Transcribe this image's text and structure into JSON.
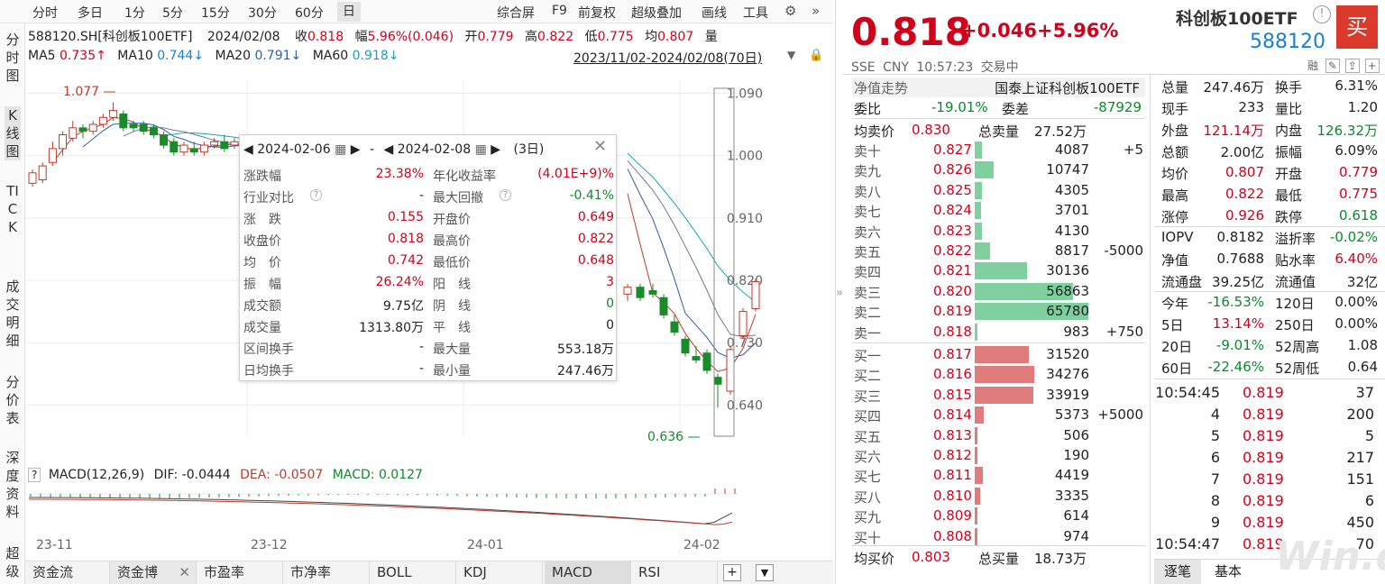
{
  "toolbar": {
    "periods": [
      "分时",
      "多日",
      "1分",
      "5分",
      "15分",
      "30分",
      "60分",
      "日"
    ],
    "active_period": "日",
    "right_items": [
      "综合屏",
      "F9",
      "前复权",
      "超级叠加",
      "画线",
      "工具"
    ]
  },
  "left_tabs": [
    "分时图",
    "K线图",
    "TICK",
    "成交明细",
    "分价表",
    "深度资料",
    "超级"
  ],
  "quote_line": {
    "code_name": "588120.SH[科创板100ETF]",
    "date": "2024/02/08",
    "close_label": "收",
    "close": "0.818",
    "range_label": "幅",
    "range": "5.96%(0.046)",
    "open_label": "开",
    "open": "0.779",
    "high_label": "高",
    "high": "0.822",
    "low_label": "低",
    "low": "0.775",
    "avg_label": "均",
    "avg": "0.807",
    "vol_label": "量"
  },
  "ma_line": {
    "ma5_label": "MA5",
    "ma5": "0.735↑",
    "ma10_label": "MA10",
    "ma10": "0.744↓",
    "ma20_label": "MA20",
    "ma20": "0.791↓",
    "ma60_label": "MA60",
    "ma60": "0.918↓",
    "date_range": "2023/11/02-2024/02/08(70日)"
  },
  "chart_data": {
    "type": "candlestick",
    "y_ticks": [
      "1.090",
      "1.000",
      "0.910",
      "0.820",
      "0.730",
      "0.640"
    ],
    "ylim": [
      0.595,
      1.11
    ],
    "x_labels": [
      "23-11",
      "23-12",
      "24-01",
      "24-02"
    ],
    "annotations": [
      {
        "text": "1.077"
      },
      {
        "text": "0.636"
      }
    ],
    "candles": [
      {
        "o": 0.96,
        "c": 0.975,
        "h": 0.98,
        "l": 0.955
      },
      {
        "o": 0.965,
        "c": 0.985,
        "h": 0.99,
        "l": 0.96
      },
      {
        "o": 0.99,
        "c": 1.01,
        "h": 1.02,
        "l": 0.985
      },
      {
        "o": 1.01,
        "c": 1.03,
        "h": 1.035,
        "l": 1.0
      },
      {
        "o": 1.025,
        "c": 1.04,
        "h": 1.05,
        "l": 1.02
      },
      {
        "o": 1.04,
        "c": 1.035,
        "h": 1.045,
        "l": 1.025
      },
      {
        "o": 1.035,
        "c": 1.045,
        "h": 1.05,
        "l": 1.03
      },
      {
        "o": 1.045,
        "c": 1.055,
        "h": 1.06,
        "l": 1.04
      },
      {
        "o": 1.055,
        "c": 1.065,
        "h": 1.077,
        "l": 1.05
      },
      {
        "o": 1.06,
        "c": 1.04,
        "h": 1.065,
        "l": 1.035
      },
      {
        "o": 1.045,
        "c": 1.04,
        "h": 1.05,
        "l": 1.035
      },
      {
        "o": 1.045,
        "c": 1.035,
        "h": 1.05,
        "l": 1.03
      },
      {
        "o": 1.04,
        "c": 1.03,
        "h": 1.045,
        "l": 1.025
      },
      {
        "o": 1.03,
        "c": 1.015,
        "h": 1.035,
        "l": 1.01
      },
      {
        "o": 1.02,
        "c": 1.005,
        "h": 1.025,
        "l": 1.0
      },
      {
        "o": 1.005,
        "c": 1.015,
        "h": 1.02,
        "l": 1.0
      },
      {
        "o": 1.01,
        "c": 1.005,
        "h": 1.02,
        "l": 1.0
      },
      {
        "o": 1.005,
        "c": 1.015,
        "h": 1.02,
        "l": 1.0
      },
      {
        "o": 1.015,
        "c": 1.02,
        "h": 1.025,
        "l": 1.01
      },
      {
        "o": 1.02,
        "c": 1.01,
        "h": 1.03,
        "l": 1.005
      },
      {
        "o": 1.015,
        "c": 1.02,
        "h": 1.025,
        "l": 1.01
      },
      {
        "o": 1.02,
        "c": 1.015,
        "h": 1.025,
        "l": 1.01
      },
      {
        "o": 1.02,
        "c": 1.01,
        "h": 1.025,
        "l": 1.005
      },
      {
        "o": 0.8,
        "c": 0.81,
        "h": 0.815,
        "l": 0.79
      },
      {
        "o": 0.81,
        "c": 0.795,
        "h": 0.815,
        "l": 0.79
      },
      {
        "o": 0.805,
        "c": 0.8,
        "h": 0.815,
        "l": 0.795
      },
      {
        "o": 0.795,
        "c": 0.77,
        "h": 0.8,
        "l": 0.765
      },
      {
        "o": 0.76,
        "c": 0.745,
        "h": 0.77,
        "l": 0.74
      },
      {
        "o": 0.735,
        "c": 0.715,
        "h": 0.74,
        "l": 0.71
      },
      {
        "o": 0.71,
        "c": 0.705,
        "h": 0.725,
        "l": 0.7
      },
      {
        "o": 0.715,
        "c": 0.69,
        "h": 0.72,
        "l": 0.685
      },
      {
        "o": 0.68,
        "c": 0.67,
        "h": 0.685,
        "l": 0.636
      },
      {
        "o": 0.66,
        "c": 0.72,
        "h": 0.725,
        "l": 0.655
      },
      {
        "o": 0.74,
        "c": 0.775,
        "h": 0.78,
        "l": 0.735
      },
      {
        "o": 0.779,
        "c": 0.818,
        "h": 0.822,
        "l": 0.775
      }
    ],
    "ma_series": [
      {
        "name": "MA5",
        "color": "#c0392b"
      },
      {
        "name": "MA10",
        "color": "#2d5fa5"
      },
      {
        "name": "MA20",
        "color": "#6b7b90"
      },
      {
        "name": "MA60",
        "color": "#1aa3b8"
      }
    ]
  },
  "popup": {
    "date_from": "2024-02-06",
    "date_to": "2024-02-08",
    "days": "(3日)",
    "rows": [
      {
        "l1": "涨跌幅",
        "v1": "23.38%",
        "l2": "年化收益率",
        "v2": "(4.01E+9)%",
        "c1": "red",
        "c2": "red"
      },
      {
        "l1": "行业对比",
        "v1": "-",
        "l2": "最大回撤",
        "v2": "-0.41%",
        "c1": "",
        "c2": "green"
      },
      {
        "l1": "涨　跌",
        "v1": "0.155",
        "l2": "开盘价",
        "v2": "0.649",
        "c1": "red",
        "c2": "red"
      },
      {
        "l1": "收盘价",
        "v1": "0.818",
        "l2": "最高价",
        "v2": "0.822",
        "c1": "red",
        "c2": "red"
      },
      {
        "l1": "均　价",
        "v1": "0.742",
        "l2": "最低价",
        "v2": "0.648",
        "c1": "red",
        "c2": "red"
      },
      {
        "l1": "振　幅",
        "v1": "26.24%",
        "l2": "阳　线",
        "v2": "3",
        "c1": "red",
        "c2": "red"
      },
      {
        "l1": "成交额",
        "v1": "9.75亿",
        "l2": "阴　线",
        "v2": "0",
        "c1": "",
        "c2": "green"
      },
      {
        "l1": "成交量",
        "v1": "1313.80万",
        "l2": "平　线",
        "v2": "0",
        "c1": "",
        "c2": ""
      },
      {
        "l1": "区间换手",
        "v1": "-",
        "l2": "最大量",
        "v2": "553.18万",
        "c1": "",
        "c2": ""
      },
      {
        "l1": "日均换手",
        "v1": "-",
        "l2": "最小量",
        "v2": "247.46万",
        "c1": "",
        "c2": ""
      }
    ]
  },
  "macd": {
    "label": "MACD(12,26,9)",
    "dif_label": "DIF:",
    "dif": "-0.0444",
    "dea_label": "DEA:",
    "dea": "-0.0507",
    "macd_label": "MACD:",
    "macd": "0.0127"
  },
  "bottom_tabs": [
    "资金流",
    "资金博",
    "市盈率",
    "市净率",
    "BOLL",
    "KDJ",
    "MACD",
    "RSI"
  ],
  "active_bottom_tab": "MACD",
  "header": {
    "price": "0.818",
    "change": "+0.046",
    "change_pct": "+5.96%",
    "name": "科创板100ETF",
    "code": "588120",
    "exchange": "SSE",
    "currency": "CNY",
    "time": "10:57:23",
    "status": "交易中",
    "buy_button": "买",
    "small_tag": "融"
  },
  "orderbook": {
    "nav_label": "净值走势",
    "index_name": "国泰上证科创板100ETF",
    "weibi_label": "委比",
    "weibi": "-19.01%",
    "weicha_label": "委差",
    "weicha": "-87929",
    "avg_sell_label": "均卖价",
    "avg_sell": "0.830",
    "total_sell_label": "总卖量",
    "total_sell": "27.52万",
    "asks": [
      {
        "label": "卖十",
        "price": "0.827",
        "vol": "4087",
        "delta": "+5",
        "bar": 4087
      },
      {
        "label": "卖九",
        "price": "0.826",
        "vol": "10747",
        "delta": "",
        "bar": 10747
      },
      {
        "label": "卖八",
        "price": "0.825",
        "vol": "4305",
        "delta": "",
        "bar": 4305
      },
      {
        "label": "卖七",
        "price": "0.824",
        "vol": "3701",
        "delta": "",
        "bar": 3701
      },
      {
        "label": "卖六",
        "price": "0.823",
        "vol": "4130",
        "delta": "",
        "bar": 4130
      },
      {
        "label": "卖五",
        "price": "0.822",
        "vol": "8817",
        "delta": "-5000",
        "bar": 8817
      },
      {
        "label": "卖四",
        "price": "0.821",
        "vol": "30136",
        "delta": "",
        "bar": 30136
      },
      {
        "label": "卖三",
        "price": "0.820",
        "vol": "56863",
        "delta": "",
        "bar": 56863
      },
      {
        "label": "卖二",
        "price": "0.819",
        "vol": "65780",
        "delta": "",
        "bar": 65780
      },
      {
        "label": "卖一",
        "price": "0.818",
        "vol": "983",
        "delta": "+750",
        "bar": 983
      }
    ],
    "bids": [
      {
        "label": "买一",
        "price": "0.817",
        "vol": "31520",
        "delta": "",
        "bar": 31520
      },
      {
        "label": "买二",
        "price": "0.816",
        "vol": "34276",
        "delta": "",
        "bar": 34276
      },
      {
        "label": "买三",
        "price": "0.815",
        "vol": "33919",
        "delta": "",
        "bar": 33919
      },
      {
        "label": "买四",
        "price": "0.814",
        "vol": "5373",
        "delta": "+5000",
        "bar": 5373
      },
      {
        "label": "买五",
        "price": "0.813",
        "vol": "506",
        "delta": "",
        "bar": 506
      },
      {
        "label": "买六",
        "price": "0.812",
        "vol": "190",
        "delta": "",
        "bar": 190
      },
      {
        "label": "买七",
        "price": "0.811",
        "vol": "4419",
        "delta": "",
        "bar": 4419
      },
      {
        "label": "买八",
        "price": "0.810",
        "vol": "3335",
        "delta": "",
        "bar": 3335
      },
      {
        "label": "买九",
        "price": "0.809",
        "vol": "614",
        "delta": "",
        "bar": 614
      },
      {
        "label": "买十",
        "price": "0.808",
        "vol": "974",
        "delta": "",
        "bar": 974
      }
    ],
    "avg_buy_label": "均买价",
    "avg_buy": "0.803",
    "total_buy_label": "总买量",
    "total_buy": "18.73万"
  },
  "stats": [
    {
      "l1": "总量",
      "v1": "247.46万",
      "c1": "",
      "l2": "换手",
      "v2": "6.31%",
      "c2": ""
    },
    {
      "l1": "现手",
      "v1": "233",
      "c1": "",
      "l2": "量比",
      "v2": "1.20",
      "c2": ""
    },
    {
      "l1": "外盘",
      "v1": "121.14万",
      "c1": "red",
      "l2": "内盘",
      "v2": "126.32万",
      "c2": "green"
    },
    {
      "l1": "总额",
      "v1": "2.00亿",
      "c1": "",
      "l2": "振幅",
      "v2": "6.09%",
      "c2": ""
    },
    {
      "l1": "均价",
      "v1": "0.807",
      "c1": "red",
      "l2": "开盘",
      "v2": "0.779",
      "c2": "red"
    },
    {
      "l1": "最高",
      "v1": "0.822",
      "c1": "red",
      "l2": "最低",
      "v2": "0.775",
      "c2": "red"
    },
    {
      "l1": "涨停",
      "v1": "0.926",
      "c1": "red",
      "l2": "跌停",
      "v2": "0.618",
      "c2": "green"
    },
    {
      "l1": "IOPV",
      "v1": "0.8182",
      "c1": "",
      "l2": "溢折率",
      "v2": "-0.02%",
      "c2": "green"
    },
    {
      "l1": "净值",
      "v1": "0.7688",
      "c1": "",
      "l2": "贴水率",
      "v2": "6.40%",
      "c2": "red"
    },
    {
      "l1": "流通盘",
      "v1": "39.25亿",
      "c1": "",
      "l2": "流通值",
      "v2": "32亿",
      "c2": ""
    },
    {
      "l1": "今年",
      "v1": "-16.53%",
      "c1": "green",
      "l2": "120日",
      "v2": "0.00%",
      "c2": ""
    },
    {
      "l1": "5日",
      "v1": "13.14%",
      "c1": "red",
      "l2": "250日",
      "v2": "0.00%",
      "c2": ""
    },
    {
      "l1": "20日",
      "v1": "-9.01%",
      "c1": "green",
      "l2": "52周高",
      "v2": "1.08",
      "c2": ""
    },
    {
      "l1": "60日",
      "v1": "-22.46%",
      "c1": "green",
      "l2": "52周低",
      "v2": "0.64",
      "c2": ""
    }
  ],
  "trades": [
    {
      "t": "10:54:45",
      "p": "0.819",
      "v": "37"
    },
    {
      "t": "4",
      "p": "0.819",
      "v": "200"
    },
    {
      "t": "5",
      "p": "0.819",
      "v": "5"
    },
    {
      "t": "6",
      "p": "0.819",
      "v": "217"
    },
    {
      "t": "7",
      "p": "0.819",
      "v": "151"
    },
    {
      "t": "8",
      "p": "0.819",
      "v": "6"
    },
    {
      "t": "9",
      "p": "0.819",
      "v": "450"
    },
    {
      "t": "10:54:47",
      "p": "0.819",
      "v": "70"
    }
  ],
  "trade_tabs": [
    "逐笔",
    "基本"
  ],
  "watermark": "Win.d",
  "colors": {
    "up": "#d0021b",
    "down": "#0a8a2a",
    "ask_bar": "#7fcf9f",
    "bid_bar": "#e07c7c"
  }
}
